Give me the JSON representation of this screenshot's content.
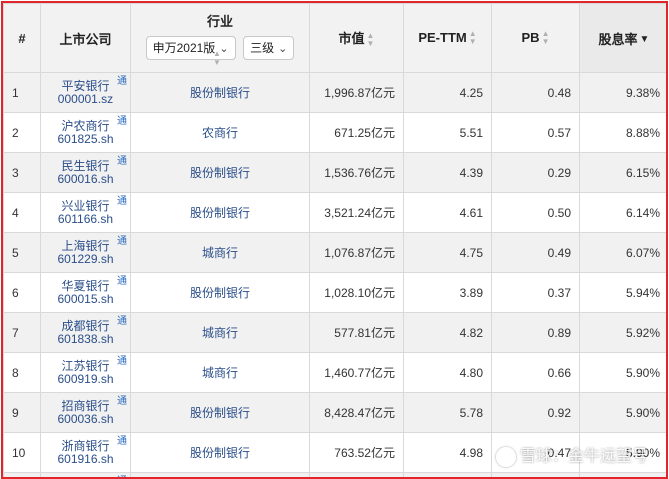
{
  "header": {
    "index": "#",
    "company": "上市公司",
    "industry": "行业",
    "industry_standard": "申万2021版",
    "industry_level": "三级",
    "market_cap": "市值",
    "pe_ttm": "PE-TTM",
    "pb": "PB",
    "dividend_yield": "股息率"
  },
  "rows": [
    {
      "idx": "1",
      "name": "平安银行",
      "code": "000001.sz",
      "tag": "通",
      "industry": "股份制银行",
      "cap": "1,996.87亿元",
      "pe": "4.25",
      "pb": "0.48",
      "dy": "9.38%"
    },
    {
      "idx": "2",
      "name": "沪农商行",
      "code": "601825.sh",
      "tag": "通",
      "industry": "农商行",
      "cap": "671.25亿元",
      "pe": "5.51",
      "pb": "0.57",
      "dy": "8.88%"
    },
    {
      "idx": "3",
      "name": "民生银行",
      "code": "600016.sh",
      "tag": "通",
      "industry": "股份制银行",
      "cap": "1,536.76亿元",
      "pe": "4.39",
      "pb": "0.29",
      "dy": "6.15%"
    },
    {
      "idx": "4",
      "name": "兴业银行",
      "code": "601166.sh",
      "tag": "通",
      "industry": "股份制银行",
      "cap": "3,521.24亿元",
      "pe": "4.61",
      "pb": "0.50",
      "dy": "6.14%"
    },
    {
      "idx": "5",
      "name": "上海银行",
      "code": "601229.sh",
      "tag": "通",
      "industry": "城商行",
      "cap": "1,076.87亿元",
      "pe": "4.75",
      "pb": "0.49",
      "dy": "6.07%"
    },
    {
      "idx": "6",
      "name": "华夏银行",
      "code": "600015.sh",
      "tag": "通",
      "industry": "股份制银行",
      "cap": "1,028.10亿元",
      "pe": "3.89",
      "pb": "0.37",
      "dy": "5.94%"
    },
    {
      "idx": "7",
      "name": "成都银行",
      "code": "601838.sh",
      "tag": "通",
      "industry": "城商行",
      "cap": "577.81亿元",
      "pe": "4.82",
      "pb": "0.89",
      "dy": "5.92%"
    },
    {
      "idx": "8",
      "name": "江苏银行",
      "code": "600919.sh",
      "tag": "通",
      "industry": "城商行",
      "cap": "1,460.77亿元",
      "pe": "4.80",
      "pb": "0.66",
      "dy": "5.90%"
    },
    {
      "idx": "9",
      "name": "招商银行",
      "code": "600036.sh",
      "tag": "通",
      "industry": "股份制银行",
      "cap": "8,428.47亿元",
      "pe": "5.78",
      "pb": "0.92",
      "dy": "5.90%"
    },
    {
      "idx": "10",
      "name": "浙商银行",
      "code": "601916.sh",
      "tag": "通",
      "industry": "股份制银行",
      "cap": "763.52亿元",
      "pe": "4.98",
      "pb": "0.47",
      "dy": "5.90%"
    }
  ],
  "partial_row_tag": "通",
  "watermark": "雪球：金牛远望号",
  "colors": {
    "frame_border": "#e0262c",
    "link": "#2a4e8a",
    "tag": "#2a6bbf",
    "header_bg": "#f2f2f2",
    "row_alt_bg": "#f1f1f1"
  },
  "icons": {
    "sort": "sort-both-icon",
    "sort_desc": "sort-desc-icon",
    "dropdown": "chevron-down-icon"
  }
}
